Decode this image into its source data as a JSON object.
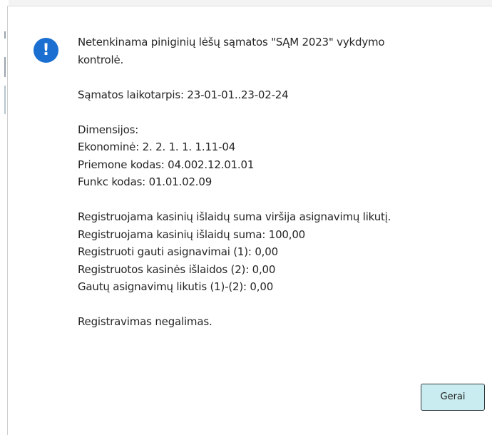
{
  "dialog": {
    "icon": "info-icon",
    "icon_glyph": "!",
    "accent_color": "#1a6fd1",
    "message": {
      "title_line1": "Netenkinama piniginių lėšų sąmatos \"SĄM 2023\" vykdymo",
      "title_line2": "kontrolė.",
      "period": "Sąmatos laikotarpis: 23-01-01..23-02-24",
      "dimensions_header": "Dimensijos:",
      "economic": "Ekonominė: 2. 2. 1. 1. 1.11-04",
      "measure_code": "Priemone kodas: 04.002.12.01.01",
      "function_code": "Funkc kodas: 01.01.02.09",
      "exceeds": "Registruojama kasinių išlaidų suma viršija asignavimų likutį.",
      "registered_sum": "Registruojama kasinių išlaidų suma: 100,00",
      "received_allocations": "Registruoti gauti asignavimai (1): 0,00",
      "registered_expenses": "Registruotos kasinės išlaidos (2): 0,00",
      "balance": "Gautų asignavimų likutis (1)-(2): 0,00",
      "conclusion": "Registravimas negalimas."
    },
    "ok_label": "Gerai",
    "button_color": "#c9ecf0"
  }
}
